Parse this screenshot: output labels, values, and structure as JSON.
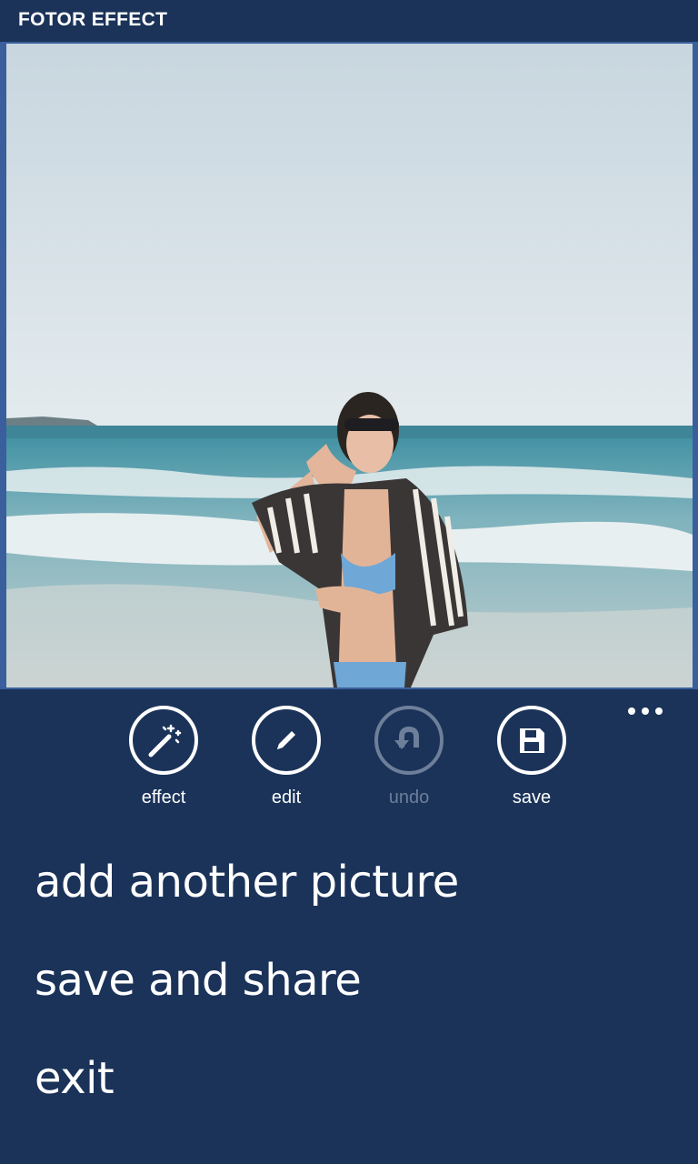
{
  "app": {
    "title": "FOTOR EFFECT"
  },
  "appbar": {
    "buttons": [
      {
        "label": "effect",
        "icon": "magic-wand-icon",
        "enabled": true
      },
      {
        "label": "edit",
        "icon": "pencil-icon",
        "enabled": true
      },
      {
        "label": "undo",
        "icon": "undo-icon",
        "enabled": false
      },
      {
        "label": "save",
        "icon": "floppy-disk-icon",
        "enabled": true
      }
    ],
    "more_icon": "ellipsis-icon"
  },
  "menu": {
    "items": [
      {
        "label": "add another picture"
      },
      {
        "label": "save and share"
      },
      {
        "label": "exit"
      }
    ]
  },
  "colors": {
    "background": "#1b3359",
    "foreground": "#ffffff",
    "disabled": "#6d7f99"
  }
}
